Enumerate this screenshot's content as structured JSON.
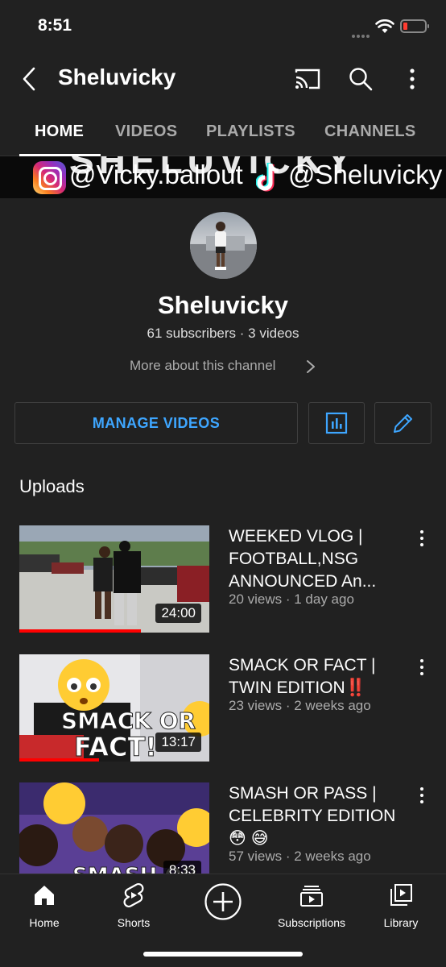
{
  "status_bar": {
    "time": "8:51"
  },
  "header": {
    "title": "Sheluvicky",
    "back_icon": "back-arrow-icon",
    "cast_icon": "cast-icon",
    "search_icon": "search-icon",
    "more_icon": "more-vert-icon"
  },
  "tabs": [
    {
      "label": "HOME",
      "active": true
    },
    {
      "label": "VIDEOS",
      "active": false
    },
    {
      "label": "PLAYLISTS",
      "active": false
    },
    {
      "label": "CHANNELS",
      "active": false
    }
  ],
  "banner": {
    "instagram": "@Vicky.ballout",
    "tiktok": "@Sheluvicky"
  },
  "channel": {
    "name": "Sheluvicky",
    "subscribers": "61 subscribers",
    "videos": "3 videos",
    "more_label": "More about this channel"
  },
  "actions": {
    "manage_label": "MANAGE VIDEOS"
  },
  "section": {
    "uploads_label": "Uploads"
  },
  "videos": [
    {
      "title": "WEEKED VLOG | FOOTBALL,NSG ANNOUNCED An...",
      "views": "20 views",
      "age": "1 day ago",
      "duration": "24:00",
      "watched": 0.64
    },
    {
      "title": "SMACK OR FACT | TWIN EDITION‼️",
      "views": "23 views",
      "age": "2 weeks ago",
      "duration": "13:17",
      "watched": 0.42,
      "thumb_text": "SMACK OR FACT!"
    },
    {
      "title": "SMASH OR PASS | CELEBRITY EDITION 😳 😅",
      "views": "57 views",
      "age": "2 weeks ago",
      "duration": "8:33",
      "thumb_text": "SMASH OR PASS!"
    }
  ],
  "bottom_nav": [
    {
      "label": "Home",
      "icon": "home-icon",
      "active": true
    },
    {
      "label": "Shorts",
      "icon": "shorts-icon"
    },
    {
      "label": "",
      "icon": "create-plus-icon"
    },
    {
      "label": "Subscriptions",
      "icon": "subscriptions-icon"
    },
    {
      "label": "Library",
      "icon": "library-icon"
    }
  ],
  "colors": {
    "background": "#212121",
    "accent": "#3ea6ff",
    "progress": "#ff0000"
  }
}
